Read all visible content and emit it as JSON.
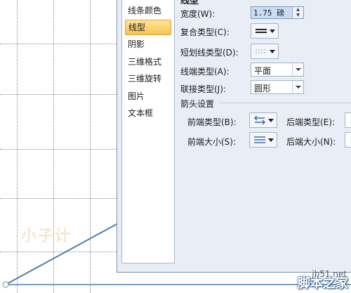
{
  "dialog": {
    "section_title": "线型",
    "nav": {
      "items": [
        {
          "label": "线条颜色",
          "active": false
        },
        {
          "label": "线型",
          "active": true
        },
        {
          "label": "阴影",
          "active": false
        },
        {
          "label": "三维格式",
          "active": false
        },
        {
          "label": "三维旋转",
          "active": false
        },
        {
          "label": "图片",
          "active": false
        },
        {
          "label": "文本框",
          "active": false
        }
      ]
    },
    "line_style": {
      "width_label": "宽度(W):",
      "width_value": "1.75 磅",
      "compound_label": "复合类型(C):",
      "dash_label": "短划线类型(D):",
      "cap_label": "线端类型(A):",
      "cap_value": "平面",
      "join_label": "联接类型(J):",
      "join_value": "圆形"
    },
    "arrow_settings": {
      "group_label": "箭头设置",
      "begin_type_label": "前端类型(B):",
      "end_type_label": "后端类型(E):",
      "begin_size_label": "前端大小(S):",
      "end_size_label": "后端大小(N):"
    }
  },
  "watermarks": {
    "faint_text": "小子计",
    "site_url": "jb51.net",
    "site_name": "脚本之家"
  },
  "colors": {
    "accent_line": "#4a7fb0",
    "nav_active": "#f6c44f",
    "dialog_bg": "#e9eef6"
  },
  "icons": [
    "spin-up-icon",
    "spin-down-icon",
    "compound-line-icon",
    "dash-line-icon",
    "arrow-type-icon",
    "arrow-size-icon",
    "chevron-down-icon"
  ]
}
